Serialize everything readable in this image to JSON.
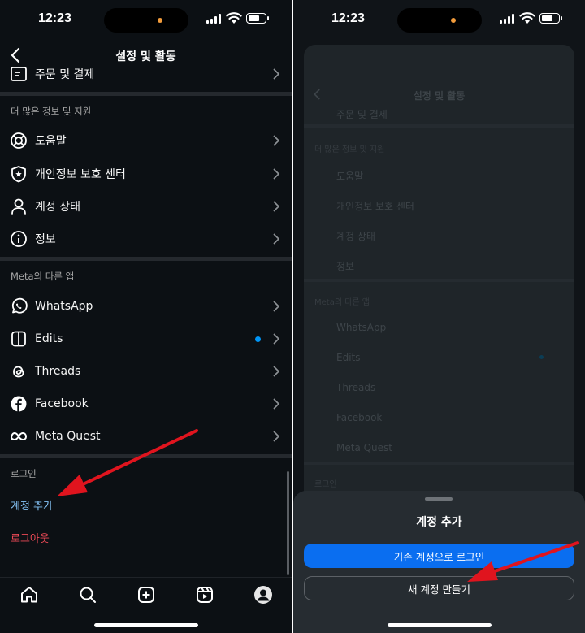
{
  "status_bar": {
    "time": "12:23"
  },
  "header": {
    "title": "설정 및 활동"
  },
  "sections": {
    "orders": {
      "item_label": "주문 및 결제"
    },
    "more_info": {
      "title": "더 많은 정보 및 지원",
      "items": [
        {
          "label": "도움말",
          "icon": "lifebuoy-icon"
        },
        {
          "label": "개인정보 보호 센터",
          "icon": "shield-star-icon"
        },
        {
          "label": "계정 상태",
          "icon": "person-icon"
        },
        {
          "label": "정보",
          "icon": "info-icon"
        }
      ]
    },
    "meta_apps": {
      "title": "Meta의 다른 앱",
      "items": [
        {
          "label": "WhatsApp",
          "icon": "whatsapp-icon"
        },
        {
          "label": "Edits",
          "icon": "edits-icon",
          "has_badge": true
        },
        {
          "label": "Threads",
          "icon": "threads-icon"
        },
        {
          "label": "Facebook",
          "icon": "facebook-icon"
        },
        {
          "label": "Meta Quest",
          "icon": "meta-quest-icon"
        }
      ]
    },
    "login": {
      "title": "로그인",
      "add_account": "계정 추가",
      "logout": "로그아웃"
    }
  },
  "nav": [
    "home-icon",
    "search-icon",
    "create-icon",
    "reels-icon",
    "profile-icon"
  ],
  "sheet": {
    "title": "계정 추가",
    "login_existing": "기존 계정으로 로그인",
    "create_new": "새 계정 만들기"
  },
  "colors": {
    "background": "#0c1014",
    "accent_blue": "#0a6ef0",
    "link_blue": "#85c3f7",
    "logout_red": "#ed4956",
    "annotation_arrow": "#e0141e"
  }
}
